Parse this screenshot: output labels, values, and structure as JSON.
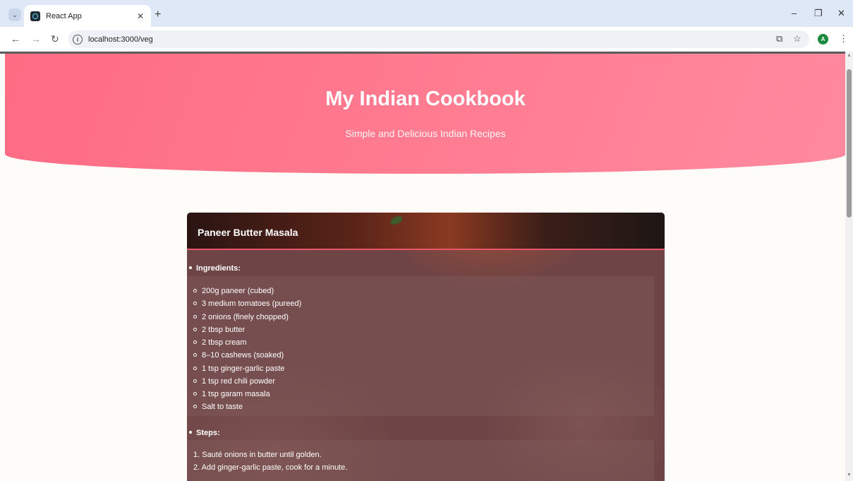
{
  "browser": {
    "tab_title": "React App",
    "url": "localhost:3000/veg",
    "avatar_letter": "A",
    "icons": {
      "tab_search": "chevron-down-icon",
      "close_tab": "close-icon",
      "new_tab": "plus-icon",
      "back": "arrow-left-icon",
      "forward": "arrow-right-icon",
      "reload": "reload-icon",
      "site_info": "info-icon",
      "cast": "cast-icon",
      "bookmark": "star-icon",
      "menu": "kebab-menu-icon"
    },
    "glyphs": {
      "tab_search": "⌄",
      "close_tab": "✕",
      "new_tab": "+",
      "back": "←",
      "forward": "→",
      "reload": "↻",
      "info": "i",
      "cast": "⧉",
      "bookmark": "☆",
      "menu": "⋮",
      "minimize": "–",
      "restore": "❐",
      "close": "✕",
      "scroll_up": "▲",
      "scroll_down": "▼"
    }
  },
  "page": {
    "title": "My Indian Cookbook",
    "subtitle": "Simple and Delicious Indian Recipes",
    "accent_color": "#fe6b84"
  },
  "recipe": {
    "name": "Paneer Butter Masala",
    "ingredients_label": "Ingredients:",
    "ingredients": [
      "200g paneer (cubed)",
      "3 medium tomatoes (pureed)",
      "2 onions (finely chopped)",
      "2 tbsp butter",
      "2 tbsp cream",
      "8–10 cashews (soaked)",
      "1 tsp ginger-garlic paste",
      "1 tsp red chili powder",
      "1 tsp garam masala",
      "Salt to taste"
    ],
    "steps_label": "Steps:",
    "steps": [
      "1. Sauté onions in butter until golden.",
      "2. Add ginger-garlic paste, cook for a minute."
    ]
  }
}
